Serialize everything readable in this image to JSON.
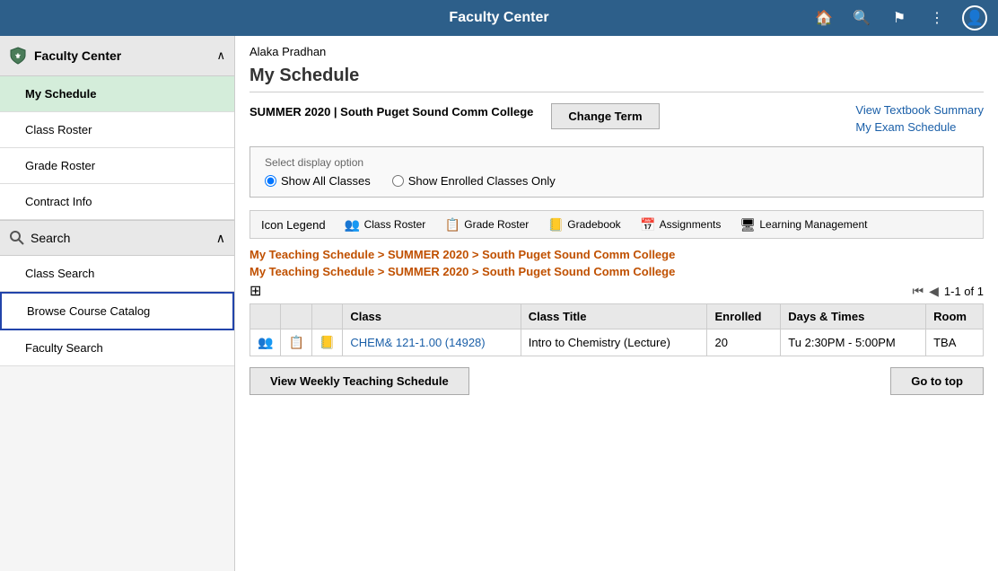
{
  "header": {
    "title": "Faculty Center",
    "icons": [
      "home",
      "search",
      "flag",
      "dots",
      "user-circle"
    ]
  },
  "sidebar": {
    "faculty_center_label": "Faculty Center",
    "items_main": [
      {
        "id": "my-schedule",
        "label": "My Schedule",
        "active": true
      },
      {
        "id": "class-roster",
        "label": "Class Roster",
        "active": false
      },
      {
        "id": "grade-roster",
        "label": "Grade Roster",
        "active": false
      },
      {
        "id": "contract-info",
        "label": "Contract Info",
        "active": false
      }
    ],
    "search_label": "Search",
    "items_search": [
      {
        "id": "class-search",
        "label": "Class Search",
        "active": false
      },
      {
        "id": "browse-course-catalog",
        "label": "Browse Course Catalog",
        "active": false,
        "highlighted": true
      },
      {
        "id": "faculty-search",
        "label": "Faculty Search",
        "active": false
      }
    ]
  },
  "content": {
    "user_name": "Alaka Pradhan",
    "page_title": "My Schedule",
    "term_label": "SUMMER 2020 | South Puget Sound Comm College",
    "change_term_btn": "Change Term",
    "view_textbook_link": "View Textbook Summary",
    "my_exam_schedule_link": "My Exam Schedule",
    "display_option_label": "Select display option",
    "radio_options": [
      {
        "id": "show-all",
        "label": "Show All Classes",
        "checked": true
      },
      {
        "id": "show-enrolled",
        "label": "Show Enrolled Classes Only",
        "checked": false
      }
    ],
    "icon_legend_bar": {
      "icon_legend_label": "Icon Legend",
      "items": [
        {
          "id": "class-roster-legend",
          "icon": "👥",
          "label": "Class Roster"
        },
        {
          "id": "grade-roster-legend",
          "icon": "📋",
          "label": "Grade Roster"
        },
        {
          "id": "gradebook-legend",
          "icon": "📒",
          "label": "Gradebook"
        },
        {
          "id": "assignments-legend",
          "icon": "📅",
          "label": "Assignments"
        },
        {
          "id": "learning-mgmt-legend",
          "icon": "🖥",
          "label": "Learning Management"
        }
      ]
    },
    "teaching_links": [
      "My Teaching Schedule > SUMMER 2020 > South Puget Sound Comm College",
      "My Teaching Schedule > SUMMER 2020 > South Puget Sound Comm College"
    ],
    "table_icon": "⊞",
    "pagination": "1-1 of 1",
    "table_headers": [
      "",
      "",
      "",
      "Class",
      "Class Title",
      "Enrolled",
      "Days & Times",
      "Room"
    ],
    "table_rows": [
      {
        "icon1": "👥",
        "icon2": "📋",
        "icon3": "📒",
        "class_link": "CHEM& 121-1.00 (14928)",
        "class_title": "Intro to Chemistry (Lecture)",
        "enrolled": "20",
        "days_times": "Tu 2:30PM - 5:00PM",
        "room": "TBA"
      }
    ],
    "view_weekly_btn": "View Weekly Teaching Schedule",
    "go_to_top_btn": "Go to top"
  }
}
